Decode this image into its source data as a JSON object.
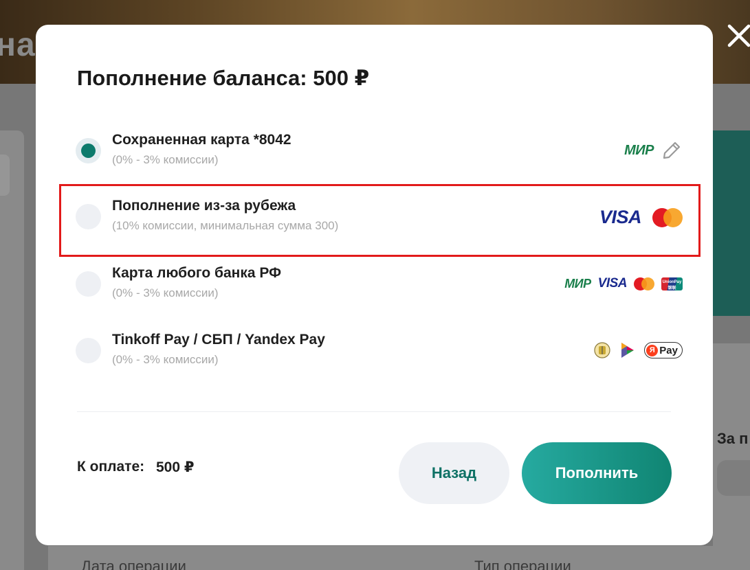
{
  "background": {
    "header_text": "нал",
    "right_text": "За п",
    "bottom_labels": [
      "Дата операции",
      "Тип операции"
    ]
  },
  "modal": {
    "title": "Пополнение баланса: 500 ₽",
    "options": [
      {
        "title": "Сохраненная карта *8042",
        "subtitle": "(0% - 3% комиссии)",
        "selected": true,
        "logos": [
          "mir-logo",
          "pencil-icon"
        ]
      },
      {
        "title": "Пополнение из-за рубежа",
        "subtitle": "(10% комиссии, минимальная сумма 300)",
        "selected": false,
        "highlighted": true,
        "logos": [
          "visa-logo",
          "mastercard-logo"
        ]
      },
      {
        "title": "Карта любого банка РФ",
        "subtitle": "(0% - 3% комиссии)",
        "selected": false,
        "logos": [
          "mir-logo",
          "visa-logo",
          "mastercard-logo",
          "unionpay-logo"
        ]
      },
      {
        "title": "Tinkoff Pay / СБП / Yandex Pay",
        "subtitle": "(0% - 3% комиссии)",
        "selected": false,
        "logos": [
          "tinkoff-logo",
          "sbp-logo",
          "yandex-pay-logo"
        ]
      }
    ],
    "logo_text": {
      "mir": "МИР",
      "visa": "VISA",
      "unionpay": "UnionPay 银联",
      "yandex_pay": "Pay",
      "yandex_mark": "Я"
    },
    "total_label": "К оплате:",
    "total_amount": "500 ₽",
    "back_button": "Назад",
    "topup_button": "Пополнить"
  },
  "colors": {
    "accent": "#0d7a6c",
    "highlight_border": "#e21a1a",
    "button_gradient_start": "#26aaa0",
    "button_gradient_end": "#108573",
    "overlay": "#7d7d7d"
  }
}
